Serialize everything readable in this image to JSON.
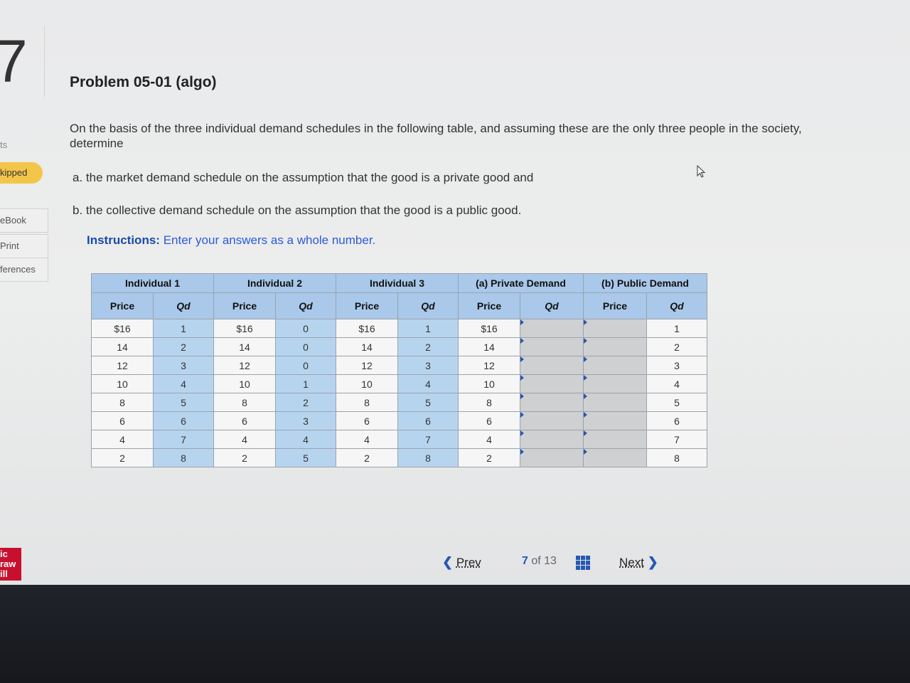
{
  "sidebar": {
    "question_number": "7",
    "points_label": "ts",
    "status_badge": "kipped",
    "links": [
      "eBook",
      "Print",
      "ferences"
    ],
    "logo_lines": [
      "ic",
      "raw",
      "ill"
    ]
  },
  "problem": {
    "title": "Problem 05-01 (algo)",
    "intro": "On the basis of the three individual demand schedules in the following table, and assuming these are the only three people in the society, determine",
    "item_a": "a. the market demand schedule on the assumption that the good is a private good and",
    "item_b": "b. the collective demand schedule on the assumption that the good is a public good.",
    "instructions_label": "Instructions:",
    "instructions_text": "Enter your answers as a whole number."
  },
  "table": {
    "group_headers": [
      "Individual 1",
      "Individual 2",
      "Individual 3",
      "(a) Private Demand",
      "(b) Public Demand"
    ],
    "column_headers": [
      "Price",
      "Qd",
      "Price",
      "Qd",
      "Price",
      "Qd",
      "Price",
      "Qd",
      "Price",
      "Qd"
    ],
    "rows": [
      [
        "$16",
        "1",
        "$16",
        "0",
        "$16",
        "1",
        "$16",
        "",
        "",
        "1"
      ],
      [
        "14",
        "2",
        "14",
        "0",
        "14",
        "2",
        "14",
        "",
        "",
        "2"
      ],
      [
        "12",
        "3",
        "12",
        "0",
        "12",
        "3",
        "12",
        "",
        "",
        "3"
      ],
      [
        "10",
        "4",
        "10",
        "1",
        "10",
        "4",
        "10",
        "",
        "",
        "4"
      ],
      [
        "8",
        "5",
        "8",
        "2",
        "8",
        "5",
        "8",
        "",
        "",
        "5"
      ],
      [
        "6",
        "6",
        "6",
        "3",
        "6",
        "6",
        "6",
        "",
        "",
        "6"
      ],
      [
        "4",
        "7",
        "4",
        "4",
        "4",
        "7",
        "4",
        "",
        "",
        "7"
      ],
      [
        "2",
        "8",
        "2",
        "5",
        "2",
        "8",
        "2",
        "",
        "",
        "8"
      ]
    ]
  },
  "pager": {
    "prev_label": "Prev",
    "current": "7",
    "of_label": "of",
    "total": "13",
    "next_label": "Next"
  }
}
